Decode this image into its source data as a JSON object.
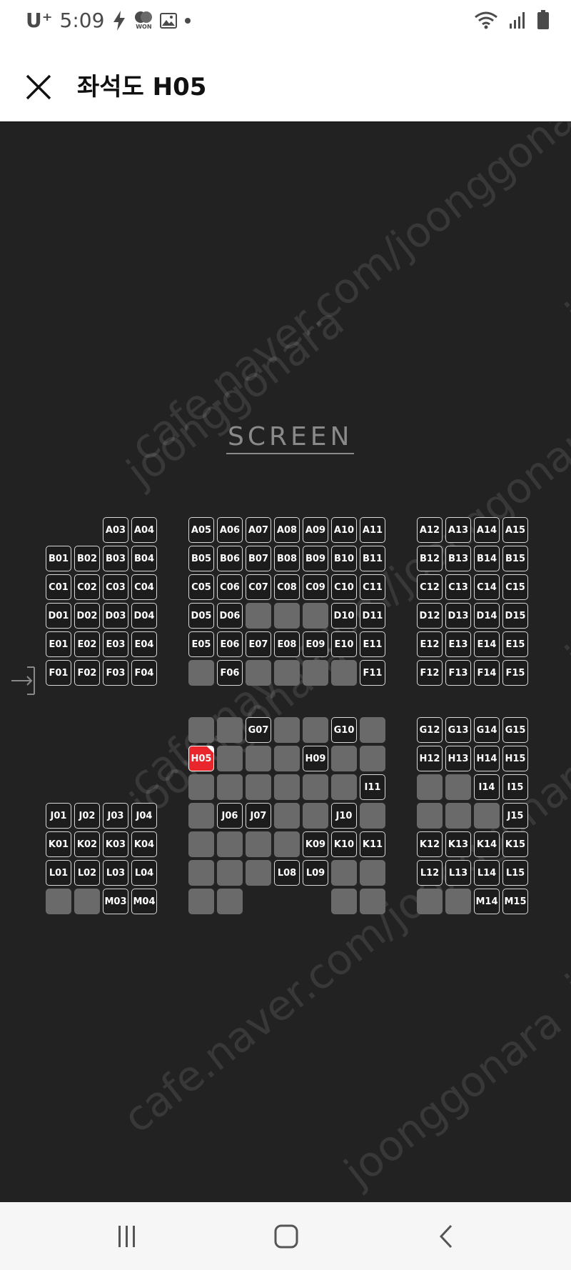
{
  "status_bar": {
    "carrier": "U⁺",
    "time": "5:09",
    "won_label": "WON"
  },
  "header": {
    "title": "좌석도 H05"
  },
  "screen_label": "SCREEN",
  "watermarks": [
    "cafe.naver.com/joonggonara",
    "joonggonara",
    "cafe.naver.com/joonggonara",
    "joonggonara",
    "cafe.naver.com/joonggonara",
    "joonggonara",
    "joonggonara",
    "joonggonara",
    "joonggonara"
  ],
  "colors": {
    "background": "#222222",
    "available_border": "#d9d9d9",
    "sold": "#6a6a6a",
    "selected": "#e8262b"
  },
  "exit_icon": "exit-arrow-icon",
  "selected_seat": "H05",
  "seats": [
    {
      "label": "A03",
      "s": "a"
    },
    {
      "label": "A04",
      "s": "a"
    },
    {
      "label": "A05",
      "s": "a"
    },
    {
      "label": "A06",
      "s": "a"
    },
    {
      "label": "A07",
      "s": "a"
    },
    {
      "label": "A08",
      "s": "a"
    },
    {
      "label": "A09",
      "s": "a"
    },
    {
      "label": "A10",
      "s": "a"
    },
    {
      "label": "A11",
      "s": "a"
    },
    {
      "label": "A12",
      "s": "a"
    },
    {
      "label": "A13",
      "s": "a"
    },
    {
      "label": "A14",
      "s": "a"
    },
    {
      "label": "A15",
      "s": "a"
    },
    {
      "label": "B01",
      "s": "a"
    },
    {
      "label": "B02",
      "s": "a"
    },
    {
      "label": "B03",
      "s": "a"
    },
    {
      "label": "B04",
      "s": "a"
    },
    {
      "label": "B05",
      "s": "a"
    },
    {
      "label": "B06",
      "s": "a"
    },
    {
      "label": "B07",
      "s": "a"
    },
    {
      "label": "B08",
      "s": "a"
    },
    {
      "label": "B09",
      "s": "a"
    },
    {
      "label": "B10",
      "s": "a"
    },
    {
      "label": "B11",
      "s": "a"
    },
    {
      "label": "B12",
      "s": "a"
    },
    {
      "label": "B13",
      "s": "a"
    },
    {
      "label": "B14",
      "s": "a"
    },
    {
      "label": "B15",
      "s": "a"
    },
    {
      "label": "C01",
      "s": "a"
    },
    {
      "label": "C02",
      "s": "a"
    },
    {
      "label": "C03",
      "s": "a"
    },
    {
      "label": "C04",
      "s": "a"
    },
    {
      "label": "C05",
      "s": "a"
    },
    {
      "label": "C06",
      "s": "a"
    },
    {
      "label": "C07",
      "s": "a"
    },
    {
      "label": "C08",
      "s": "a"
    },
    {
      "label": "C09",
      "s": "a"
    },
    {
      "label": "C10",
      "s": "a"
    },
    {
      "label": "C11",
      "s": "a"
    },
    {
      "label": "C12",
      "s": "a"
    },
    {
      "label": "C13",
      "s": "a"
    },
    {
      "label": "C14",
      "s": "a"
    },
    {
      "label": "C15",
      "s": "a"
    },
    {
      "label": "D01",
      "s": "a"
    },
    {
      "label": "D02",
      "s": "a"
    },
    {
      "label": "D03",
      "s": "a"
    },
    {
      "label": "D04",
      "s": "a"
    },
    {
      "label": "D05",
      "s": "a"
    },
    {
      "label": "D06",
      "s": "a"
    },
    {
      "label": "D07",
      "s": "x"
    },
    {
      "label": "D08",
      "s": "x"
    },
    {
      "label": "D09",
      "s": "x"
    },
    {
      "label": "D10",
      "s": "a"
    },
    {
      "label": "D11",
      "s": "a"
    },
    {
      "label": "D12",
      "s": "a"
    },
    {
      "label": "D13",
      "s": "a"
    },
    {
      "label": "D14",
      "s": "a"
    },
    {
      "label": "D15",
      "s": "a"
    },
    {
      "label": "E01",
      "s": "a"
    },
    {
      "label": "E02",
      "s": "a"
    },
    {
      "label": "E03",
      "s": "a"
    },
    {
      "label": "E04",
      "s": "a"
    },
    {
      "label": "E05",
      "s": "a"
    },
    {
      "label": "E06",
      "s": "a"
    },
    {
      "label": "E07",
      "s": "a"
    },
    {
      "label": "E08",
      "s": "a"
    },
    {
      "label": "E09",
      "s": "a"
    },
    {
      "label": "E10",
      "s": "a"
    },
    {
      "label": "E11",
      "s": "a"
    },
    {
      "label": "E12",
      "s": "a"
    },
    {
      "label": "E13",
      "s": "a"
    },
    {
      "label": "E14",
      "s": "a"
    },
    {
      "label": "E15",
      "s": "a"
    },
    {
      "label": "F01",
      "s": "a"
    },
    {
      "label": "F02",
      "s": "a"
    },
    {
      "label": "F03",
      "s": "a"
    },
    {
      "label": "F04",
      "s": "a"
    },
    {
      "label": "F05",
      "s": "x"
    },
    {
      "label": "F06",
      "s": "a"
    },
    {
      "label": "F07",
      "s": "x"
    },
    {
      "label": "F08",
      "s": "x"
    },
    {
      "label": "F09",
      "s": "x"
    },
    {
      "label": "F10",
      "s": "x"
    },
    {
      "label": "F11",
      "s": "a"
    },
    {
      "label": "F12",
      "s": "a"
    },
    {
      "label": "F13",
      "s": "a"
    },
    {
      "label": "F14",
      "s": "a"
    },
    {
      "label": "F15",
      "s": "a"
    },
    {
      "label": "G05",
      "s": "x"
    },
    {
      "label": "G06",
      "s": "x"
    },
    {
      "label": "G07",
      "s": "a"
    },
    {
      "label": "G08",
      "s": "x"
    },
    {
      "label": "G09",
      "s": "x"
    },
    {
      "label": "G10",
      "s": "a"
    },
    {
      "label": "G11",
      "s": "x"
    },
    {
      "label": "G12",
      "s": "a"
    },
    {
      "label": "G13",
      "s": "a"
    },
    {
      "label": "G14",
      "s": "a"
    },
    {
      "label": "G15",
      "s": "a"
    },
    {
      "label": "H05",
      "s": "sel"
    },
    {
      "label": "H06",
      "s": "x"
    },
    {
      "label": "H07",
      "s": "x"
    },
    {
      "label": "H08",
      "s": "x"
    },
    {
      "label": "H09",
      "s": "a"
    },
    {
      "label": "H10",
      "s": "x"
    },
    {
      "label": "H11",
      "s": "x"
    },
    {
      "label": "H12",
      "s": "a"
    },
    {
      "label": "H13",
      "s": "a"
    },
    {
      "label": "H14",
      "s": "a"
    },
    {
      "label": "H15",
      "s": "a"
    },
    {
      "label": "I05",
      "s": "x"
    },
    {
      "label": "I06",
      "s": "x"
    },
    {
      "label": "I07",
      "s": "x"
    },
    {
      "label": "I08",
      "s": "x"
    },
    {
      "label": "I09",
      "s": "x"
    },
    {
      "label": "I10",
      "s": "x"
    },
    {
      "label": "I11",
      "s": "a"
    },
    {
      "label": "I12",
      "s": "x"
    },
    {
      "label": "I13",
      "s": "x"
    },
    {
      "label": "I14",
      "s": "a"
    },
    {
      "label": "I15",
      "s": "a"
    },
    {
      "label": "J01",
      "s": "a"
    },
    {
      "label": "J02",
      "s": "a"
    },
    {
      "label": "J03",
      "s": "a"
    },
    {
      "label": "J04",
      "s": "a"
    },
    {
      "label": "J05",
      "s": "x"
    },
    {
      "label": "J06",
      "s": "a"
    },
    {
      "label": "J07",
      "s": "a"
    },
    {
      "label": "J08",
      "s": "x"
    },
    {
      "label": "J09",
      "s": "x"
    },
    {
      "label": "J10",
      "s": "a"
    },
    {
      "label": "J11",
      "s": "x"
    },
    {
      "label": "J12",
      "s": "x"
    },
    {
      "label": "J13",
      "s": "x"
    },
    {
      "label": "J14",
      "s": "x"
    },
    {
      "label": "J15",
      "s": "a"
    },
    {
      "label": "K01",
      "s": "a"
    },
    {
      "label": "K02",
      "s": "a"
    },
    {
      "label": "K03",
      "s": "a"
    },
    {
      "label": "K04",
      "s": "a"
    },
    {
      "label": "K05",
      "s": "x"
    },
    {
      "label": "K06",
      "s": "x"
    },
    {
      "label": "K07",
      "s": "x"
    },
    {
      "label": "K08",
      "s": "x"
    },
    {
      "label": "K09",
      "s": "a"
    },
    {
      "label": "K10",
      "s": "a"
    },
    {
      "label": "K11",
      "s": "a"
    },
    {
      "label": "K12",
      "s": "a"
    },
    {
      "label": "K13",
      "s": "a"
    },
    {
      "label": "K14",
      "s": "a"
    },
    {
      "label": "K15",
      "s": "a"
    },
    {
      "label": "L01",
      "s": "a"
    },
    {
      "label": "L02",
      "s": "a"
    },
    {
      "label": "L03",
      "s": "a"
    },
    {
      "label": "L04",
      "s": "a"
    },
    {
      "label": "L05",
      "s": "x"
    },
    {
      "label": "L06",
      "s": "x"
    },
    {
      "label": "L07",
      "s": "x"
    },
    {
      "label": "L08",
      "s": "a"
    },
    {
      "label": "L09",
      "s": "a"
    },
    {
      "label": "L10",
      "s": "x"
    },
    {
      "label": "L11",
      "s": "x"
    },
    {
      "label": "L12",
      "s": "a"
    },
    {
      "label": "L13",
      "s": "a"
    },
    {
      "label": "L14",
      "s": "a"
    },
    {
      "label": "L15",
      "s": "a"
    },
    {
      "label": "M01",
      "s": "x"
    },
    {
      "label": "M02",
      "s": "x"
    },
    {
      "label": "M03",
      "s": "a"
    },
    {
      "label": "M04",
      "s": "a"
    },
    {
      "label": "M05",
      "s": "x"
    },
    {
      "label": "M06",
      "s": "x"
    },
    {
      "label": "M10",
      "s": "x"
    },
    {
      "label": "M11",
      "s": "x"
    },
    {
      "label": "M12",
      "s": "x"
    },
    {
      "label": "M13",
      "s": "x"
    },
    {
      "label": "M14",
      "s": "a"
    },
    {
      "label": "M15",
      "s": "a"
    }
  ],
  "nav_bar": {
    "recent_icon": "recent-apps-icon",
    "home_icon": "home-icon",
    "back_icon": "back-icon"
  }
}
